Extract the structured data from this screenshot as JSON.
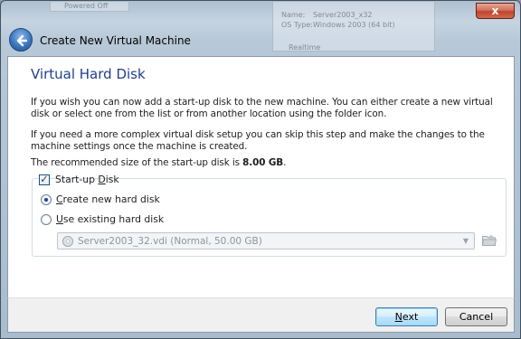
{
  "window": {
    "title": "Create New Virtual Machine",
    "close_label": "x"
  },
  "background": {
    "ghost_item_1": "Powered Off",
    "ghost_name_label": "Name:",
    "ghost_name_value": "Server2003_x32",
    "ghost_os_label": "OS Type:",
    "ghost_os_value": "Windows 2003 (64 bit)",
    "ghost_section": "Realtime"
  },
  "page": {
    "heading": "Virtual Hard Disk",
    "para1": "If you wish you can now add a start-up disk to the new machine. You can either create a new virtual disk or select one from the list or from another location using the folder icon.",
    "para2": "If you need a more complex virtual disk setup you can skip this step and make the changes to the machine settings once the machine is created.",
    "para3_prefix": "The recommended size of the start-up disk is ",
    "para3_size": "8.00 GB",
    "para3_suffix": "."
  },
  "options": {
    "startup_disk": {
      "label_prefix": "Start-up ",
      "label_mnemonic": "D",
      "label_suffix": "isk",
      "checked": true
    },
    "create_new": {
      "label_mnemonic": "C",
      "label_suffix": "reate new hard disk",
      "selected": true
    },
    "use_existing": {
      "label_mnemonic": "U",
      "label_suffix": "se existing hard disk",
      "selected": false
    },
    "existing_disk_value": "Server2003_32.vdi (Normal, 50.00 GB)"
  },
  "buttons": {
    "next_mnemonic": "N",
    "next_suffix": "ext",
    "cancel": "Cancel"
  },
  "icons": {
    "back": "back-arrow-icon",
    "close": "close-icon",
    "disk": "hard-disk-icon",
    "folder": "folder-icon",
    "dropdown": "chevron-down-icon"
  }
}
